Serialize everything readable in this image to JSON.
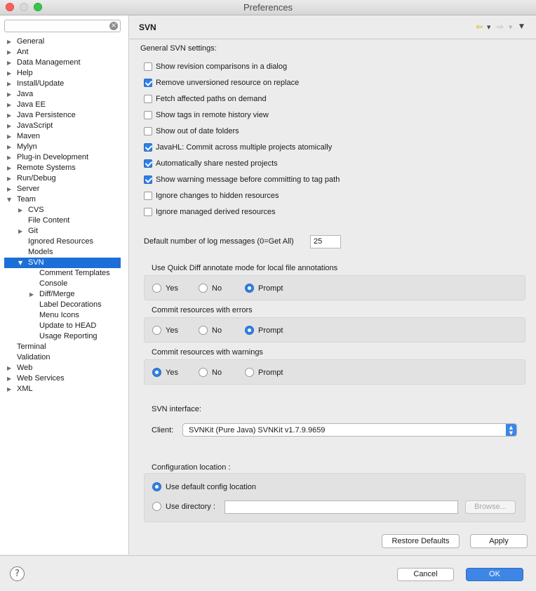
{
  "window": {
    "title": "Preferences"
  },
  "filter": {
    "placeholder": "",
    "clear_icon": "clear-icon"
  },
  "tree": [
    {
      "label": "General",
      "depth": 0,
      "arrow": "right"
    },
    {
      "label": "Ant",
      "depth": 0,
      "arrow": "right"
    },
    {
      "label": "Data Management",
      "depth": 0,
      "arrow": "right"
    },
    {
      "label": "Help",
      "depth": 0,
      "arrow": "right"
    },
    {
      "label": "Install/Update",
      "depth": 0,
      "arrow": "right"
    },
    {
      "label": "Java",
      "depth": 0,
      "arrow": "right"
    },
    {
      "label": "Java EE",
      "depth": 0,
      "arrow": "right"
    },
    {
      "label": "Java Persistence",
      "depth": 0,
      "arrow": "right"
    },
    {
      "label": "JavaScript",
      "depth": 0,
      "arrow": "right"
    },
    {
      "label": "Maven",
      "depth": 0,
      "arrow": "right"
    },
    {
      "label": "Mylyn",
      "depth": 0,
      "arrow": "right"
    },
    {
      "label": "Plug-in Development",
      "depth": 0,
      "arrow": "right"
    },
    {
      "label": "Remote Systems",
      "depth": 0,
      "arrow": "right"
    },
    {
      "label": "Run/Debug",
      "depth": 0,
      "arrow": "right"
    },
    {
      "label": "Server",
      "depth": 0,
      "arrow": "right"
    },
    {
      "label": "Team",
      "depth": 0,
      "arrow": "down"
    },
    {
      "label": "CVS",
      "depth": 1,
      "arrow": "right"
    },
    {
      "label": "File Content",
      "depth": 1,
      "arrow": ""
    },
    {
      "label": "Git",
      "depth": 1,
      "arrow": "right"
    },
    {
      "label": "Ignored Resources",
      "depth": 1,
      "arrow": ""
    },
    {
      "label": "Models",
      "depth": 1,
      "arrow": ""
    },
    {
      "label": "SVN",
      "depth": 1,
      "arrow": "down",
      "selected": true
    },
    {
      "label": "Comment Templates",
      "depth": 2,
      "arrow": ""
    },
    {
      "label": "Console",
      "depth": 2,
      "arrow": ""
    },
    {
      "label": "Diff/Merge",
      "depth": 2,
      "arrow": "right"
    },
    {
      "label": "Label Decorations",
      "depth": 2,
      "arrow": ""
    },
    {
      "label": "Menu Icons",
      "depth": 2,
      "arrow": ""
    },
    {
      "label": "Update to HEAD",
      "depth": 2,
      "arrow": ""
    },
    {
      "label": "Usage Reporting",
      "depth": 2,
      "arrow": ""
    },
    {
      "label": "Terminal",
      "depth": 0,
      "arrow": ""
    },
    {
      "label": "Validation",
      "depth": 0,
      "arrow": ""
    },
    {
      "label": "Web",
      "depth": 0,
      "arrow": "right"
    },
    {
      "label": "Web Services",
      "depth": 0,
      "arrow": "right"
    },
    {
      "label": "XML",
      "depth": 0,
      "arrow": "right"
    }
  ],
  "header": {
    "page_title": "SVN",
    "back_icon": "back-arrow-icon",
    "forward_icon": "forward-arrow-icon",
    "menu_icon": "view-menu-icon"
  },
  "general": {
    "heading": "General SVN settings:",
    "checkboxes": [
      {
        "label": "Show revision comparisons in a dialog",
        "checked": false
      },
      {
        "label": "Remove unversioned resource on replace",
        "checked": true
      },
      {
        "label": "Fetch affected paths on demand",
        "checked": false
      },
      {
        "label": "Show tags in remote history view",
        "checked": false
      },
      {
        "label": "Show out of date folders",
        "checked": false
      },
      {
        "label": "JavaHL: Commit across multiple projects atomically",
        "checked": true
      },
      {
        "label": "Automatically share nested projects",
        "checked": true
      },
      {
        "label": "Show warning message before committing to tag path",
        "checked": true
      },
      {
        "label": "Ignore changes to hidden resources",
        "checked": false
      },
      {
        "label": "Ignore managed derived resources",
        "checked": false
      }
    ]
  },
  "log_messages": {
    "label": "Default number of log messages (0=Get All)",
    "value": "25"
  },
  "radio_groups": [
    {
      "label": "Use Quick Diff annotate mode for local file annotations",
      "options": [
        "Yes",
        "No",
        "Prompt"
      ],
      "selected": "Prompt"
    },
    {
      "label": "Commit resources with errors",
      "options": [
        "Yes",
        "No",
        "Prompt"
      ],
      "selected": "Prompt"
    },
    {
      "label": "Commit resources with warnings",
      "options": [
        "Yes",
        "No",
        "Prompt"
      ],
      "selected": "Yes"
    }
  ],
  "svn_interface": {
    "label": "SVN interface:",
    "client_label": "Client:",
    "client_value": "SVNKit (Pure Java) SVNKit v1.7.9.9659"
  },
  "config_location": {
    "label": "Configuration location :",
    "default_option": "Use default config location",
    "directory_option": "Use directory :",
    "selected": "default",
    "directory_value": "",
    "browse_label": "Browse..."
  },
  "page_buttons": {
    "restore_defaults": "Restore Defaults",
    "apply": "Apply"
  },
  "footer": {
    "help_icon": "help-icon",
    "cancel": "Cancel",
    "ok": "OK"
  },
  "colors": {
    "accent": "#1c6fd6",
    "ok_button": "#3d86e6"
  }
}
